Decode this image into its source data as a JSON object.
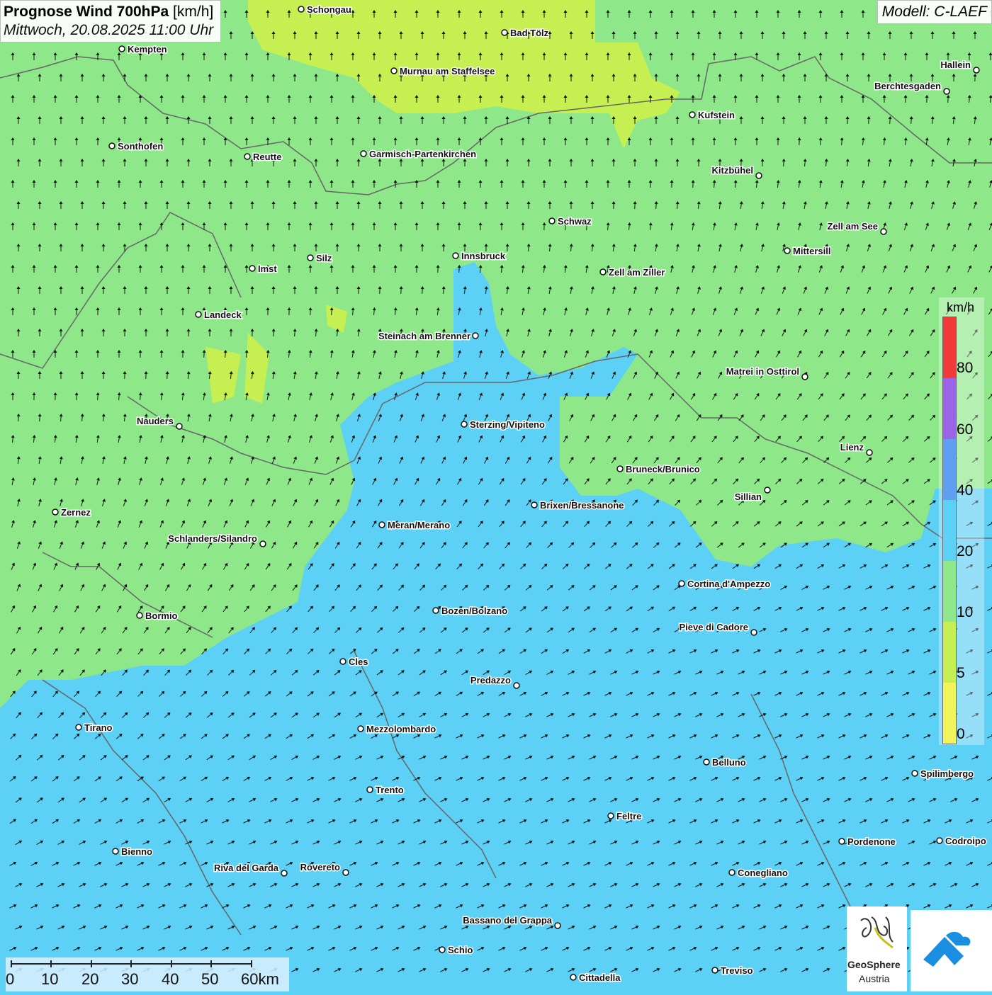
{
  "header": {
    "title_bold": "Prognose Wind 700hPa",
    "title_unit": " [km/h]",
    "subtitle": "Mittwoch, 20.08.2025 11:00 Uhr",
    "model": "Modell: C-LAEF"
  },
  "legend": {
    "unit": "km/h",
    "ticks": [
      "80",
      "60",
      "40",
      "20",
      "10",
      "5",
      "0"
    ],
    "colors": {
      "0-5": "#f2f55a",
      "5-10": "#c6ef52",
      "10-20": "#8ee88a",
      "20-40": "#5dd0f5",
      "40-60": "#5f9ef0",
      "60-80": "#9b63e8",
      "80+": "#f23a3a"
    }
  },
  "scale_bar": {
    "labels": [
      "0",
      "10",
      "20",
      "30",
      "40",
      "50",
      "60km"
    ]
  },
  "cities": [
    {
      "name": "Schongau"
    },
    {
      "name": "Bad Tölz"
    },
    {
      "name": "Kempten"
    },
    {
      "name": "Murnau am Staffelsee"
    },
    {
      "name": "Hallein"
    },
    {
      "name": "Berchtesgaden"
    },
    {
      "name": "Kufstein"
    },
    {
      "name": "Sonthofen"
    },
    {
      "name": "Reutte"
    },
    {
      "name": "Garmisch-Partenkirchen"
    },
    {
      "name": "Kitzbühel"
    },
    {
      "name": "Schwaz"
    },
    {
      "name": "Zell am See"
    },
    {
      "name": "Mittersill"
    },
    {
      "name": "Silz"
    },
    {
      "name": "Innsbruck"
    },
    {
      "name": "Imst"
    },
    {
      "name": "Zell am Ziller"
    },
    {
      "name": "Landeck"
    },
    {
      "name": "Steinach am Brenner"
    },
    {
      "name": "Matrei in Osttirol"
    },
    {
      "name": "Nauders"
    },
    {
      "name": "Sterzing/Vipiteno"
    },
    {
      "name": "Lienz"
    },
    {
      "name": "Bruneck/Brunico"
    },
    {
      "name": "Sillian"
    },
    {
      "name": "Zernez"
    },
    {
      "name": "Brixen/Bressanone"
    },
    {
      "name": "Meran/Merano"
    },
    {
      "name": "Schlanders/Silandro"
    },
    {
      "name": "Cortina d'Ampezzo"
    },
    {
      "name": "Bozen/Bolzano"
    },
    {
      "name": "Bormio"
    },
    {
      "name": "Pieve di Cadore"
    },
    {
      "name": "Cles"
    },
    {
      "name": "Predazzo"
    },
    {
      "name": "Tirano"
    },
    {
      "name": "Mezzolombardo"
    },
    {
      "name": "Belluno"
    },
    {
      "name": "Spilimbergo"
    },
    {
      "name": "Trento"
    },
    {
      "name": "Feltre"
    },
    {
      "name": "Pordenone"
    },
    {
      "name": "Codroipo"
    },
    {
      "name": "Bienno"
    },
    {
      "name": "Riva del Garda"
    },
    {
      "name": "Rovereto"
    },
    {
      "name": "Conegliano"
    },
    {
      "name": "Bassano del Grappa"
    },
    {
      "name": "Schio"
    },
    {
      "name": "Treviso"
    },
    {
      "name": "Cittadella"
    }
  ],
  "logo": {
    "line1": "GeoSphere",
    "line2": "Austria"
  }
}
